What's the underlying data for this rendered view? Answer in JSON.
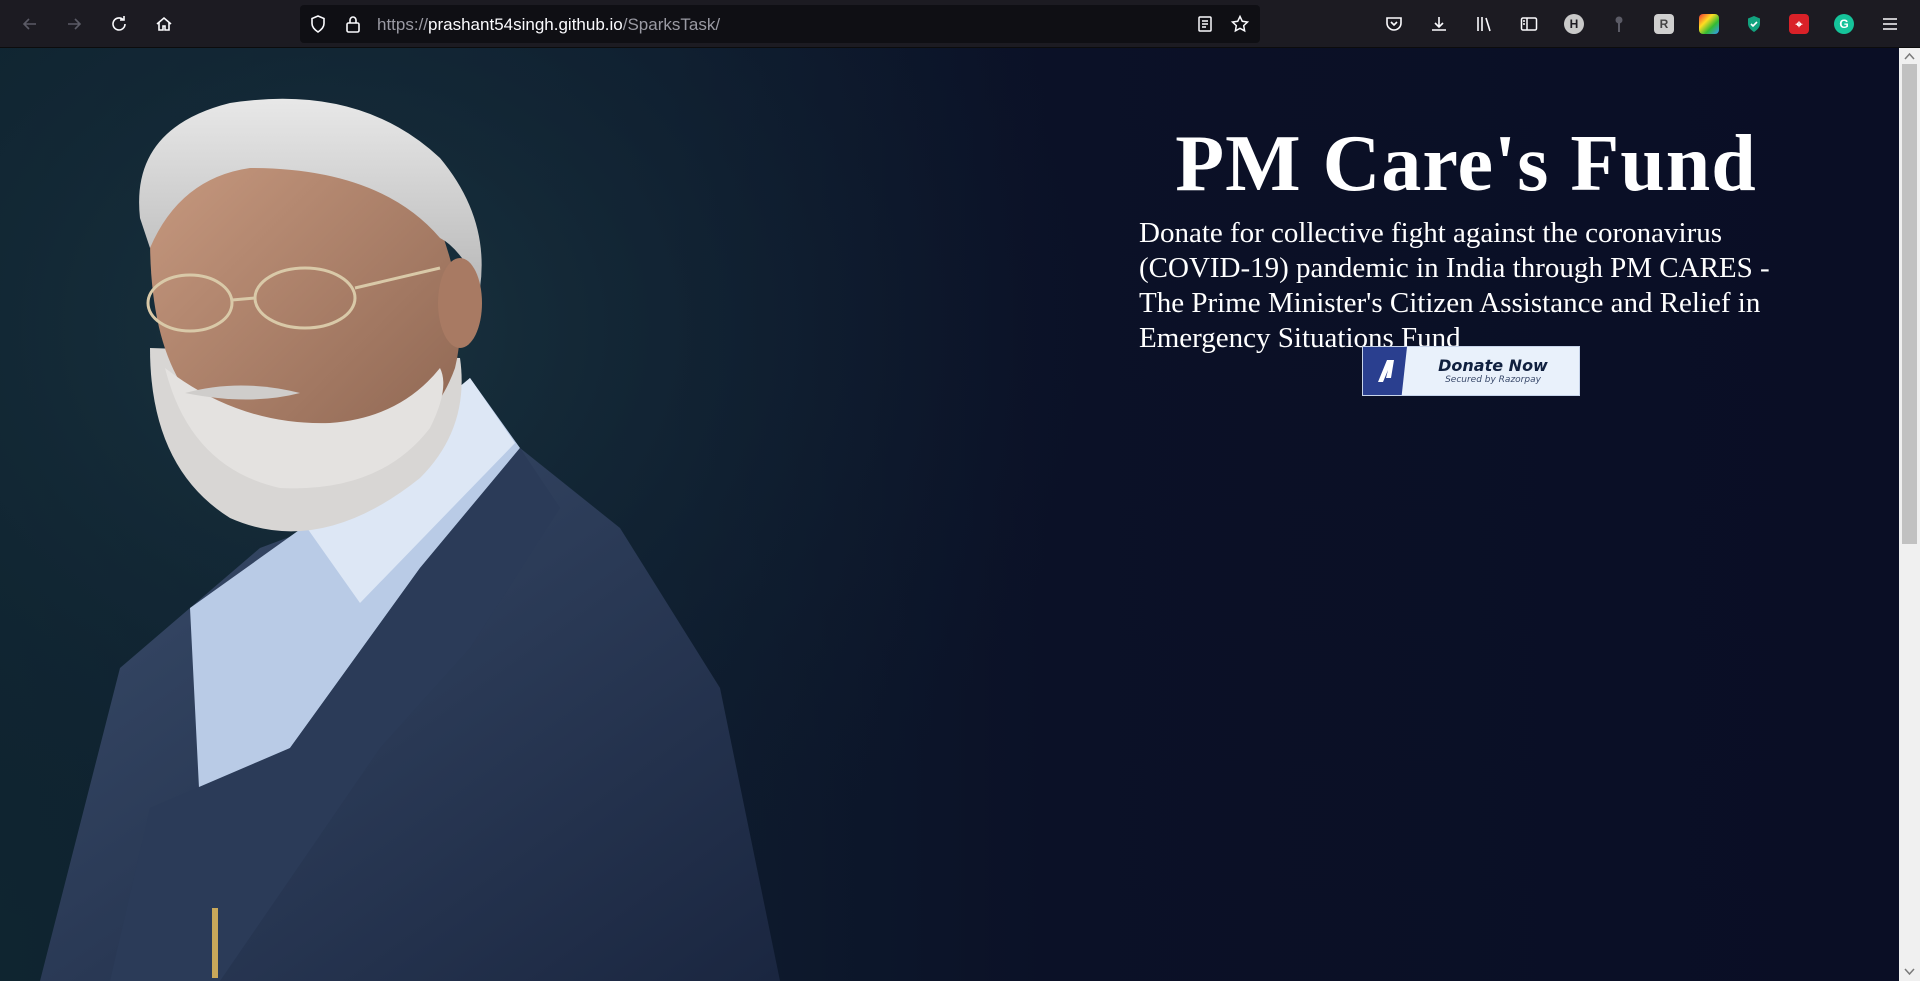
{
  "browser": {
    "url_prefix": "https://",
    "url_host": "prashant54singh.github.io",
    "url_path": "/SparksTask/",
    "nav_icons": [
      "back-arrow-icon",
      "forward-arrow-icon",
      "reload-icon",
      "home-icon"
    ],
    "toolbar_icons": [
      "pocket-icon",
      "download-icon",
      "library-icon",
      "sidebar-icon",
      "h-extension-icon",
      "key-icon",
      "r-extension-icon",
      "colorful-extension-icon",
      "shield-check-icon",
      "red-extension-icon",
      "grammarly-icon",
      "menu-icon"
    ],
    "extension_badges": {
      "h": "H",
      "g": "G"
    }
  },
  "page": {
    "title": "PM Care's Fund",
    "description": "Donate for collective fight against the coronavirus (COVID-19) pandemic in India through PM CARES - The Prime Minister's Citizen Assistance and Relief in Emergency Situations Fund",
    "donate_button": {
      "label": "Donate Now",
      "sublabel": "Secured by Razorpay"
    }
  },
  "colors": {
    "page_bg": "#0b0f24",
    "button_bg": "#e9f1fb",
    "razorpay_blue": "#2a3f8f"
  }
}
